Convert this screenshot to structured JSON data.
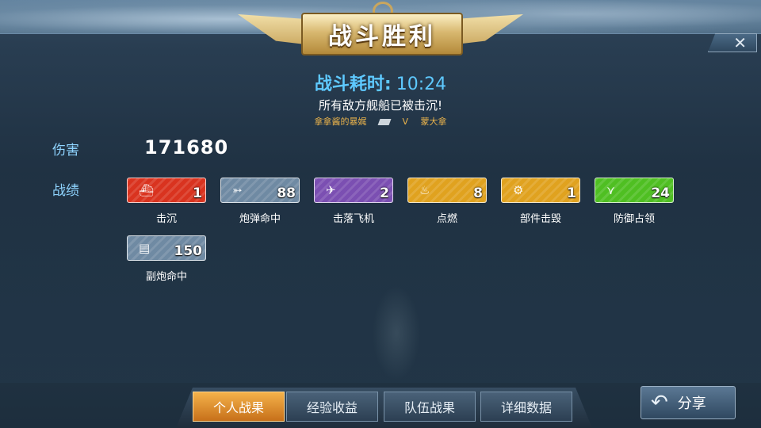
{
  "header": {
    "title": "战斗胜利",
    "close_label": "✕",
    "time_label": "战斗耗时:",
    "time_value": "10:24",
    "message": "所有敌方舰船已被击沉!",
    "player": "拿拿酱的暴娓",
    "vs": "V",
    "opponent": "蒙大拿"
  },
  "damage": {
    "label": "伤害",
    "value": "171680"
  },
  "stats": {
    "label": "战绩",
    "items": [
      {
        "icon": "sink-ship-icon",
        "glyph": "⛴",
        "count": "1",
        "caption": "击沉",
        "color": "#d9331f"
      },
      {
        "icon": "shell-hit-icon",
        "glyph": "➳",
        "count": "88",
        "caption": "炮弹命中",
        "color": "#6f8aa3"
      },
      {
        "icon": "plane-shot-icon",
        "glyph": "✈",
        "count": "2",
        "caption": "击落飞机",
        "color": "#7b4fb2"
      },
      {
        "icon": "fire-icon",
        "glyph": "♨",
        "count": "8",
        "caption": "点燃",
        "color": "#e0a21f"
      },
      {
        "icon": "gear-broken-icon",
        "glyph": "⚙",
        "count": "1",
        "caption": "部件击毁",
        "color": "#e0a21f"
      },
      {
        "icon": "defense-chevron-icon",
        "glyph": "⋎",
        "count": "24",
        "caption": "防御占领",
        "color": "#4fbf22"
      },
      {
        "icon": "secondary-gun-icon",
        "glyph": "▤",
        "count": "150",
        "caption": "副炮命中",
        "color": "#6f8aa3"
      }
    ]
  },
  "tabs": [
    {
      "label": "个人战果",
      "active": true
    },
    {
      "label": "经验收益",
      "active": false
    },
    {
      "label": "队伍战果",
      "active": false
    },
    {
      "label": "详细数据",
      "active": false
    }
  ],
  "share": {
    "label": "分享",
    "icon": "share-arrow-icon"
  }
}
